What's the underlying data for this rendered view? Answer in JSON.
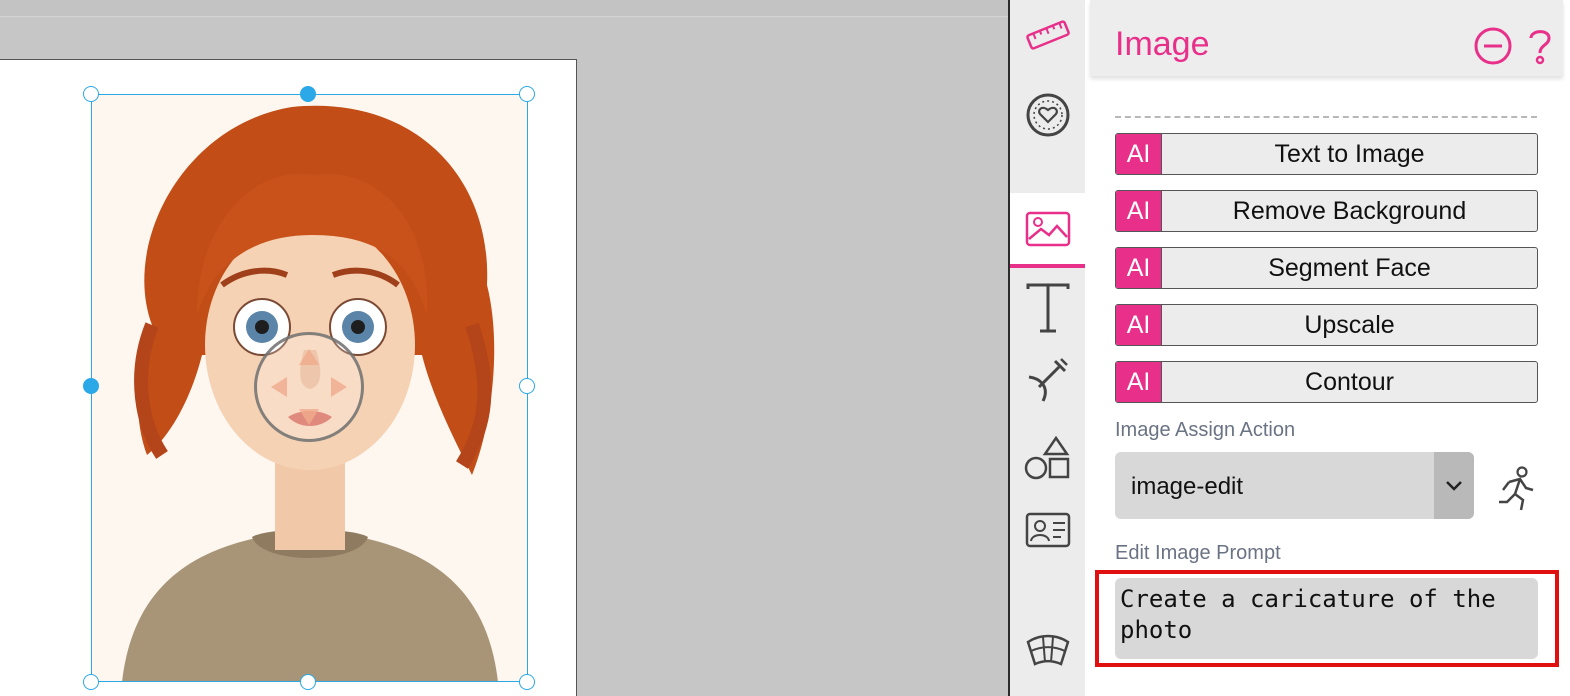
{
  "panel": {
    "title": "Image",
    "icons": {
      "collapse": "minus-circle-icon",
      "help": "question-icon"
    }
  },
  "tool_rail": [
    {
      "name": "ruler-icon"
    },
    {
      "name": "heart-badge-icon"
    },
    {
      "name": "image-icon",
      "active": true
    },
    {
      "name": "text-tool-icon"
    },
    {
      "name": "pen-tool-icon"
    },
    {
      "name": "shapes-icon"
    },
    {
      "name": "id-card-icon"
    },
    {
      "name": "arc-grid-icon"
    }
  ],
  "ai_actions": [
    {
      "tag": "AI",
      "label": "Text to Image"
    },
    {
      "tag": "AI",
      "label": "Remove Background"
    },
    {
      "tag": "AI",
      "label": "Segment Face"
    },
    {
      "tag": "AI",
      "label": "Upscale"
    },
    {
      "tag": "AI",
      "label": "Contour"
    }
  ],
  "assign_action": {
    "label": "Image Assign Action",
    "value": "image-edit"
  },
  "edit_prompt": {
    "label": "Edit Image Prompt",
    "value": "Create a caricature of the photo"
  },
  "colors": {
    "accent": "#e8308a",
    "selection": "#2aa8e8",
    "highlight": "#e01010"
  }
}
